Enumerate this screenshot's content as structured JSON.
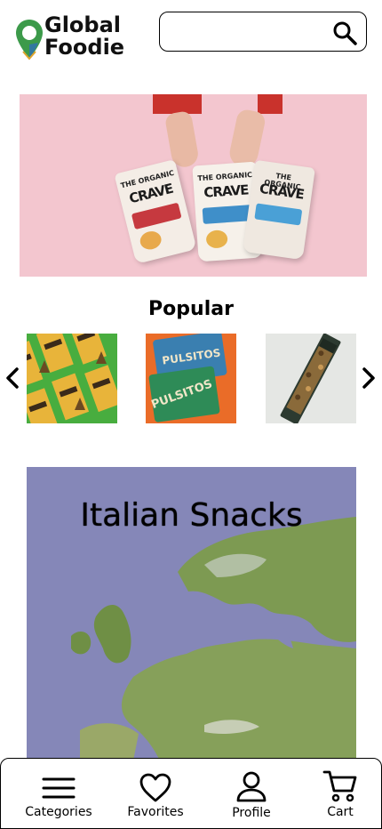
{
  "app": {
    "logo_line1": "Global",
    "logo_line2": "Foodie"
  },
  "search": {
    "value": "",
    "placeholder": ""
  },
  "hero": {
    "bag_brand": "CRAVE",
    "bag_labels": [
      "THE ORGANIC",
      "THE ORGANIC",
      "THE ORGANIC"
    ]
  },
  "popular": {
    "title": "Popular",
    "items": [
      {
        "icon": "muddy-bites-product-image"
      },
      {
        "icon": "pulsitos-product-image"
      },
      {
        "icon": "snack-bar-product-image"
      }
    ]
  },
  "featured": {
    "title": "Italian Snacks"
  },
  "nav": {
    "items": [
      {
        "label": "Categories",
        "icon": "hamburger-menu-icon"
      },
      {
        "label": "Favorites",
        "icon": "heart-icon"
      },
      {
        "label": "Profile",
        "icon": "user-icon"
      },
      {
        "label": "Cart",
        "icon": "cart-icon"
      }
    ]
  },
  "colors": {
    "hero_background": "#f3c6cf",
    "map_water": "#8587b8",
    "map_land": "#7f9a4f",
    "logo_pin_green": "#3c9a4a"
  }
}
